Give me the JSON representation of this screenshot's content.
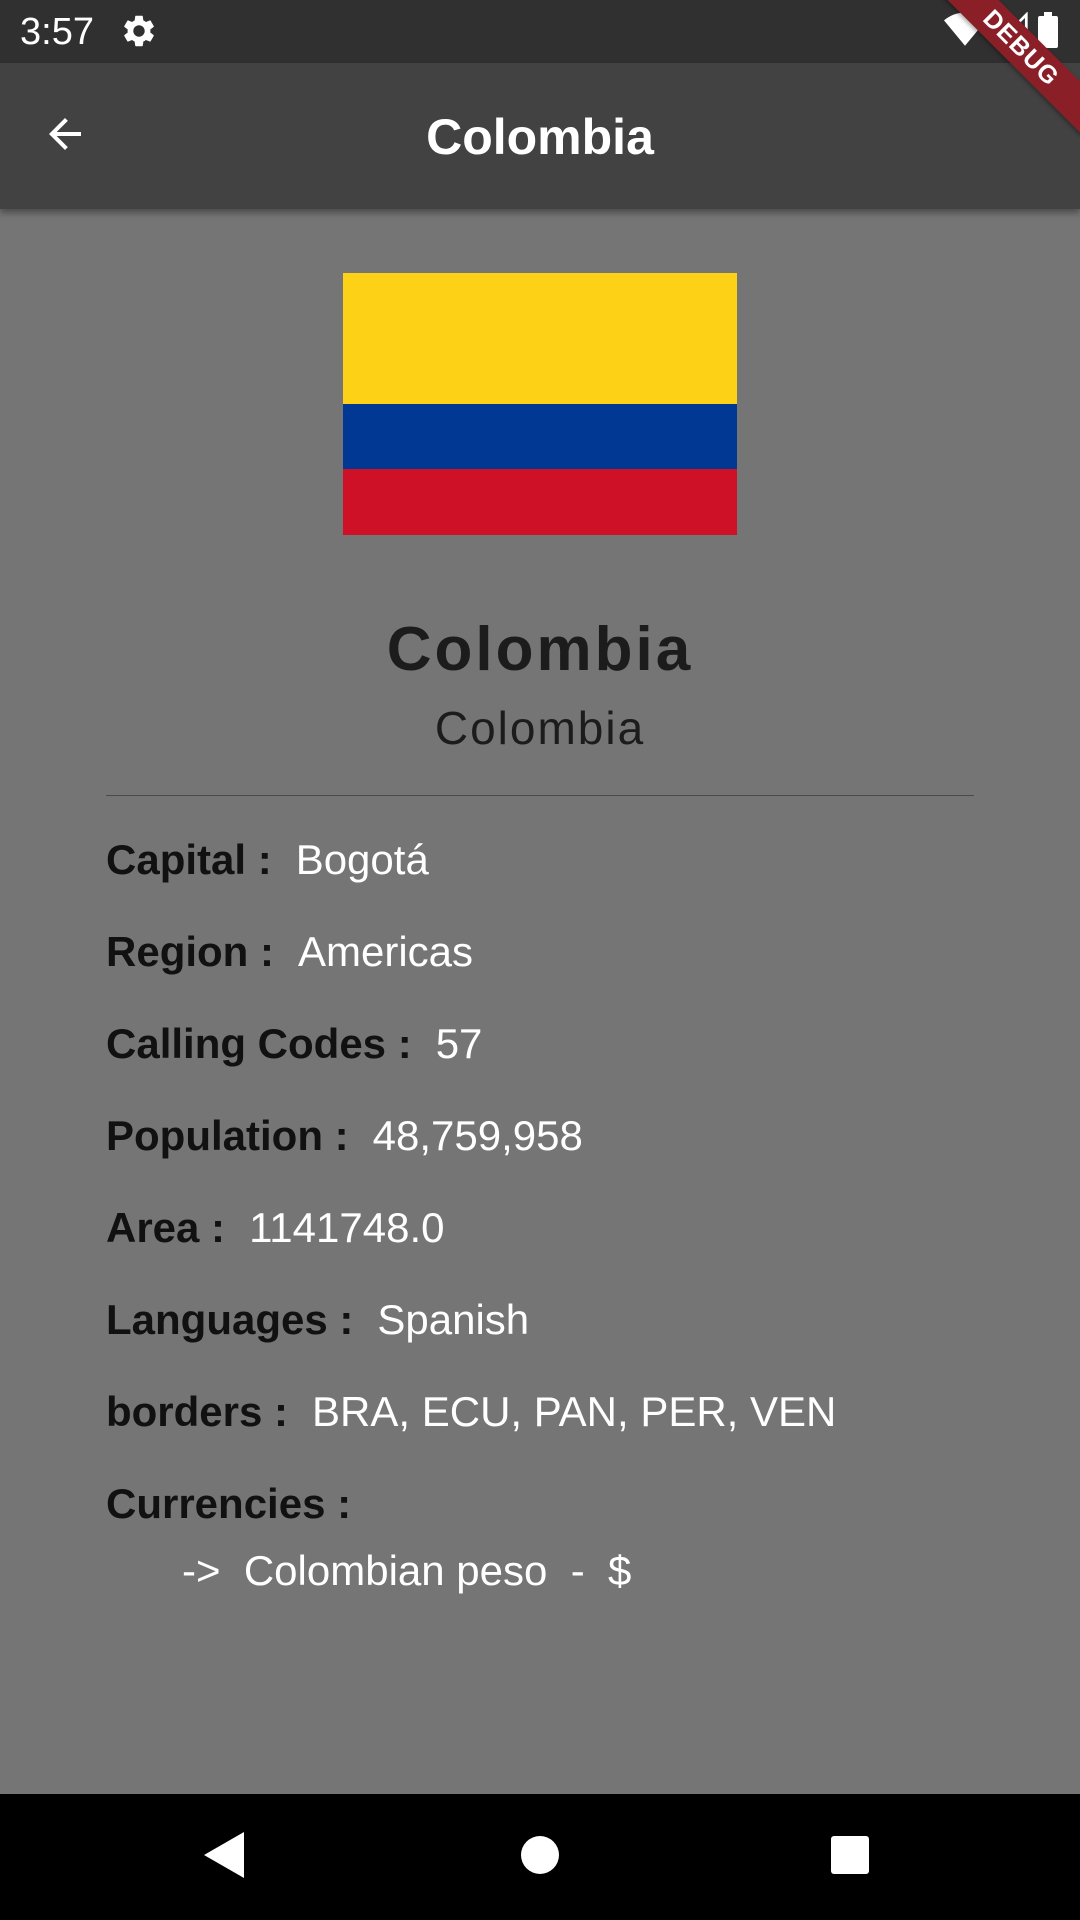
{
  "status_bar": {
    "time": "3:57",
    "icons": [
      "gear-icon",
      "wifi-icon",
      "signal-icon",
      "battery-icon"
    ]
  },
  "debug_banner": {
    "label": "DEBUG",
    "color": "#8b1f28"
  },
  "app_bar": {
    "title": "Colombia",
    "back_icon": "arrow-back-icon",
    "background": "#424242"
  },
  "flag": {
    "icon": "colombia-flag",
    "colors": [
      "#fcd116",
      "#003893",
      "#ce1126"
    ]
  },
  "country": {
    "name": "Colombia",
    "native_name": "Colombia"
  },
  "details": [
    {
      "label": "Capital :",
      "value": "Bogotá"
    },
    {
      "label": "Region :",
      "value": "Americas"
    },
    {
      "label": "Calling Codes :",
      "value": "57"
    },
    {
      "label": "Population :",
      "value": "48,759,958"
    },
    {
      "label": "Area :",
      "value": "1141748.0"
    },
    {
      "label": "Languages :",
      "value": "Spanish"
    },
    {
      "label": "borders :",
      "value": "BRA, ECU, PAN, PER, VEN"
    }
  ],
  "currencies": {
    "label": "Currencies :",
    "items": [
      "->  Colombian peso  -  $"
    ]
  },
  "nav_bar": {
    "icons": [
      "nav-back-icon",
      "nav-home-icon",
      "nav-recents-icon"
    ]
  }
}
